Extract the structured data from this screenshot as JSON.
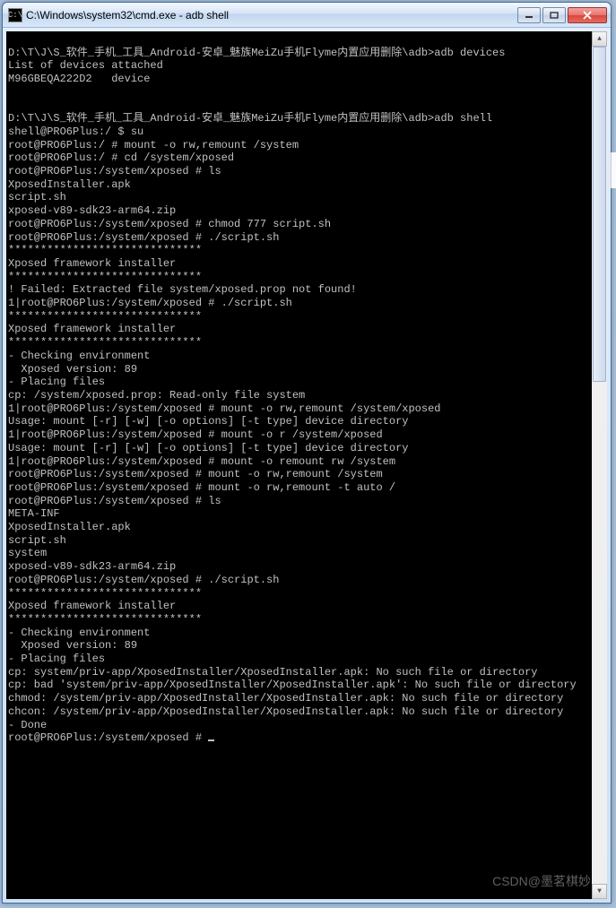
{
  "window": {
    "title": "C:\\Windows\\system32\\cmd.exe - adb  shell",
    "icon_glyph": "C:\\"
  },
  "terminal": {
    "lines": [
      "",
      "D:\\T\\J\\S_软件_手机_工具_Android-安卓_魅族MeiZu手机Flyme内置应用删除\\adb>adb devices",
      "List of devices attached",
      "M96GBEQA222D2   device",
      "",
      "",
      "D:\\T\\J\\S_软件_手机_工具_Android-安卓_魅族MeiZu手机Flyme内置应用删除\\adb>adb shell",
      "shell@PRO6Plus:/ $ su",
      "root@PRO6Plus:/ # mount -o rw,remount /system",
      "root@PRO6Plus:/ # cd /system/xposed",
      "root@PRO6Plus:/system/xposed # ls",
      "XposedInstaller.apk",
      "script.sh",
      "xposed-v89-sdk23-arm64.zip",
      "root@PRO6Plus:/system/xposed # chmod 777 script.sh",
      "root@PRO6Plus:/system/xposed # ./script.sh",
      "******************************",
      "Xposed framework installer",
      "******************************",
      "! Failed: Extracted file system/xposed.prop not found!",
      "1|root@PRO6Plus:/system/xposed # ./script.sh",
      "******************************",
      "Xposed framework installer",
      "******************************",
      "- Checking environment",
      "  Xposed version: 89",
      "- Placing files",
      "cp: /system/xposed.prop: Read-only file system",
      "1|root@PRO6Plus:/system/xposed # mount -o rw,remount /system/xposed",
      "Usage: mount [-r] [-w] [-o options] [-t type] device directory",
      "1|root@PRO6Plus:/system/xposed # mount -o r /system/xposed",
      "Usage: mount [-r] [-w] [-o options] [-t type] device directory",
      "1|root@PRO6Plus:/system/xposed # mount -o remount rw /system",
      "root@PRO6Plus:/system/xposed # mount -o rw,remount /system",
      "root@PRO6Plus:/system/xposed # mount -o rw,remount -t auto /",
      "root@PRO6Plus:/system/xposed # ls",
      "META-INF",
      "XposedInstaller.apk",
      "script.sh",
      "system",
      "xposed-v89-sdk23-arm64.zip",
      "root@PRO6Plus:/system/xposed # ./script.sh",
      "******************************",
      "Xposed framework installer",
      "******************************",
      "- Checking environment",
      "  Xposed version: 89",
      "- Placing files",
      "cp: system/priv-app/XposedInstaller/XposedInstaller.apk: No such file or directory",
      "cp: bad 'system/priv-app/XposedInstaller/XposedInstaller.apk': No such file or directory",
      "chmod: /system/priv-app/XposedInstaller/XposedInstaller.apk: No such file or directory",
      "chcon: /system/priv-app/XposedInstaller/XposedInstaller.apk: No such file or directory",
      "- Done"
    ],
    "prompt": "root@PRO6Plus:/system/xposed # "
  },
  "watermark": "CSDN@墨茗棋妙"
}
